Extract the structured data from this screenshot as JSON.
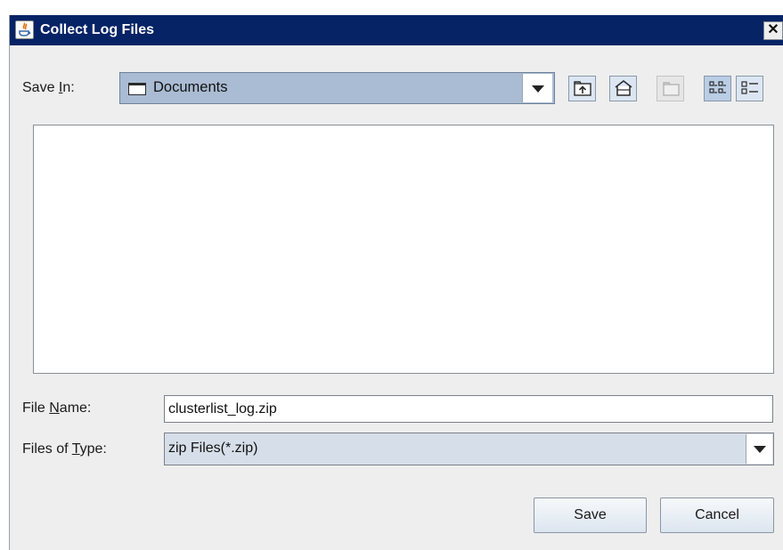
{
  "window": {
    "title": "Collect Log Files",
    "close_glyph": "✕"
  },
  "save_in": {
    "label_before": "Save ",
    "mnemonic": "I",
    "label_after": "n:",
    "value": "Documents",
    "icon": "folder-icon"
  },
  "toolbar": {
    "buttons": [
      {
        "name": "up-one-level-icon",
        "enabled": true
      },
      {
        "name": "home-icon",
        "enabled": true
      },
      {
        "name": "create-new-folder-icon",
        "enabled": false
      },
      {
        "name": "list-view-icon",
        "enabled": true,
        "selected": true
      },
      {
        "name": "details-view-icon",
        "enabled": true
      }
    ]
  },
  "file_list": {
    "items": []
  },
  "file_name": {
    "label_before": "File ",
    "mnemonic": "N",
    "label_after": "ame:",
    "value": "clusterlist_log.zip"
  },
  "files_of_type": {
    "label_before": "Files of ",
    "mnemonic": "T",
    "label_after": "ype:",
    "value": "zip Files(*.zip)"
  },
  "buttons": {
    "save": "Save",
    "cancel": "Cancel"
  },
  "colors": {
    "titlebar": "#062366",
    "dialog_background": "#eeeeee",
    "combo_selected": "#a9bcd3"
  }
}
